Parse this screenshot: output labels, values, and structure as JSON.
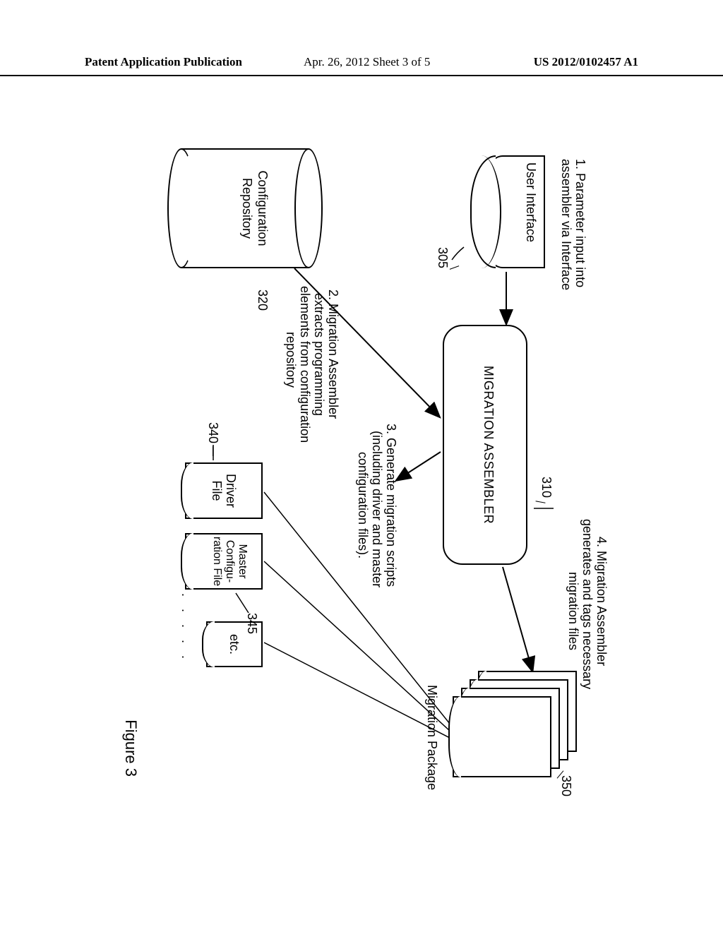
{
  "header": {
    "left": "Patent Application Publication",
    "mid": "Apr. 26, 2012  Sheet 3 of 5",
    "right": "US 2012/0102457 A1"
  },
  "figure": {
    "label": "Figure 3",
    "shapes": {
      "user_interface": "User Interface",
      "assembler": "MIGRATION ASSEMBLER",
      "repository_l1": "Configuration",
      "repository_l2": "Repository",
      "driver_file_l1": "Driver",
      "driver_file_l2": "File",
      "master_cfg_l1": "Master",
      "master_cfg_l2": "Configu-",
      "master_cfg_l3": "ration File",
      "etc": "etc.",
      "migration_package": "Migration Package"
    },
    "annotations": {
      "step1_l1": "1. Parameter input into",
      "step1_l2": "assembler via Interface",
      "step2_l1": "2. Migration Assembler",
      "step2_l2": "extracts programming",
      "step2_l3": "elements from configuration",
      "step2_l4": "repository",
      "step3_l1": "3. Generate migration scripts",
      "step3_l2": "(including driver and master",
      "step3_l3": "configuration files).",
      "step4_l1": "4. Migration Assembler",
      "step4_l2": "generates and tags necessary",
      "step4_l3": "migration files"
    },
    "refs": {
      "r305": "305",
      "r310": "310",
      "r320": "320",
      "r340": "340",
      "r345": "345",
      "r350": "350"
    },
    "dots": ". . . . ."
  }
}
